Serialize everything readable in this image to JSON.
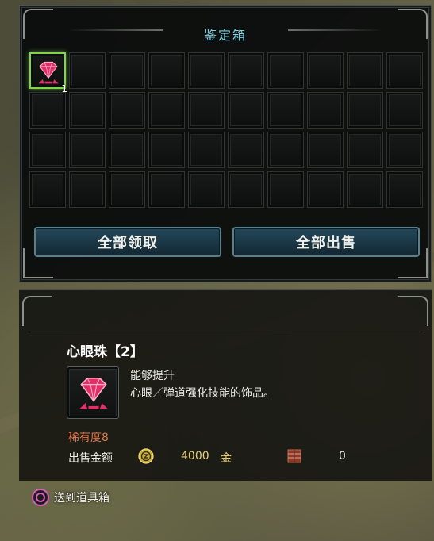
{
  "window": {
    "title": "鉴定箱"
  },
  "grid": {
    "rows": 4,
    "columns": 10,
    "items": [
      {
        "icon": "red-gem-icon",
        "quantity": "1",
        "selected": true
      }
    ]
  },
  "buttons": {
    "claim_all": "全部领取",
    "sell_all": "全部出售"
  },
  "detail": {
    "name": "心眼珠【2】",
    "icon": "red-gem-icon",
    "description_line1": "能够提升",
    "description_line2": "心眼／弹道强化技能的饰品。",
    "rarity": "稀有度8",
    "sell_label": "出售金额",
    "sell_price": "4000",
    "currency": "金",
    "points_value": "0"
  },
  "footer": {
    "hint_label": "送到道具箱",
    "hint_button": "circle-button-icon"
  },
  "colors": {
    "title": "#7fd1e0",
    "selected_border": "#7fd64a",
    "rarity": "#e0774a",
    "price": "#e9d070",
    "gem": "#e0306a"
  }
}
